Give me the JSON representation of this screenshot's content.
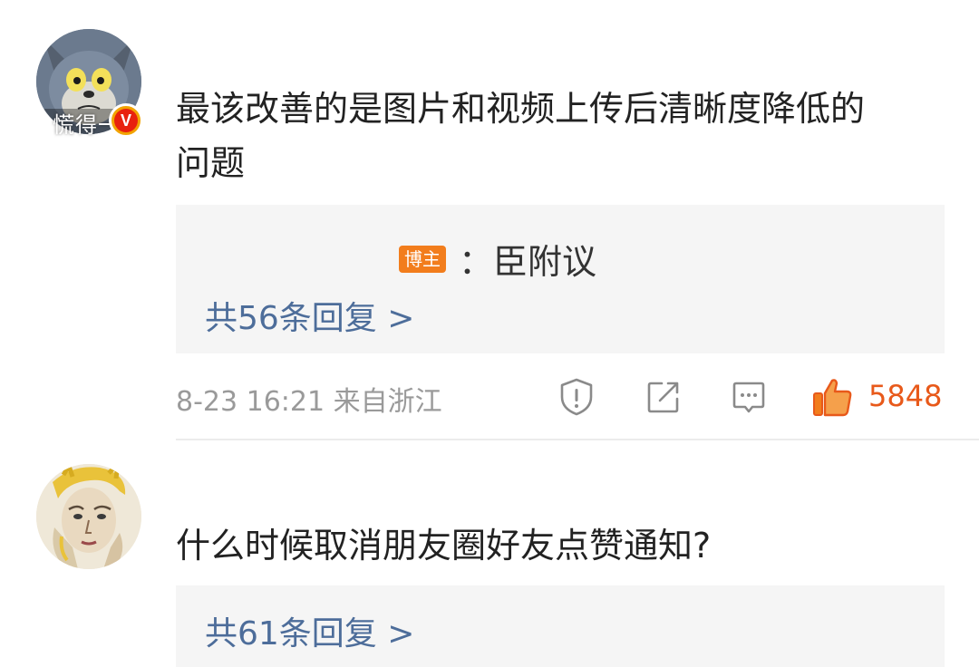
{
  "comments": [
    {
      "avatar": "tom-cat-avatar",
      "avatar_caption": "慌得一",
      "verified_badge": "V",
      "text_line1": "最该改善的是图片和视频上传后清晰度降低的",
      "text_line2": "问题",
      "author_reply_tag": "博主",
      "author_reply_text": "：臣附议",
      "reply_count": "共56条回复 >",
      "time": "8-23 16:21 来自浙江",
      "like_count": "5848",
      "icons": [
        "report-icon",
        "share-icon",
        "comment-icon",
        "like-icon"
      ]
    },
    {
      "avatar": "illustrated-person-avatar",
      "text": "什么时候取消朋友圈好友点赞通知?",
      "reply_count": "共61条回复 >"
    }
  ],
  "colors": {
    "link_blue": "#4d6d9a",
    "like_orange": "#e8591a",
    "meta_gray": "#9a9a9a",
    "reply_bg": "#f5f5f5",
    "author_tag": "#f27d1c"
  }
}
